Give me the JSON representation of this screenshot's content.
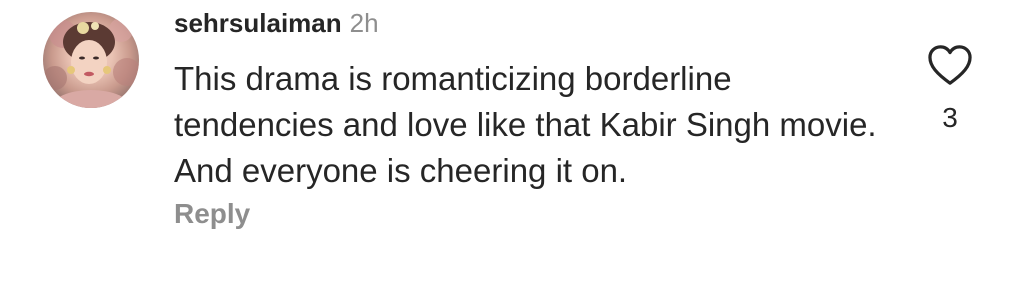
{
  "comment": {
    "username": "sehrsulaiman",
    "timestamp": "2h",
    "text": "This drama is romanticizing borderline tendencies and love like that Kabir Singh movie. And everyone is cheering it on.",
    "reply_label": "Reply",
    "like_count": "3"
  },
  "icons": {
    "avatar": "avatar-photo",
    "like": "heart-outline-icon"
  },
  "colors": {
    "primary_text": "#262626",
    "secondary_text": "#8e8e8e",
    "background": "#ffffff"
  }
}
